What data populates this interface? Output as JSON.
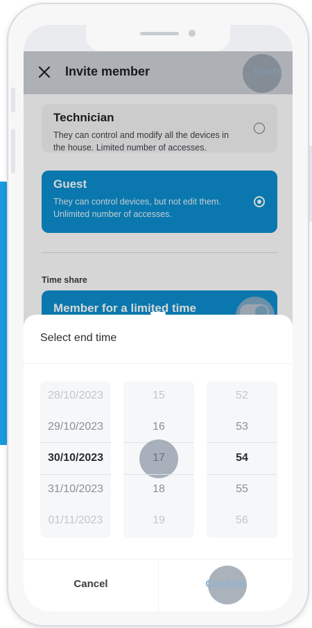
{
  "header": {
    "title": "Invite member",
    "invite_label": "Invite"
  },
  "roles": [
    {
      "title": "Technician",
      "description": "They can control and modify all the devices in the house. Limited number of accesses.",
      "selected": false
    },
    {
      "title": "Guest",
      "description": "They can control devices, but not edit them. Unlimited number of accesses.",
      "selected": true
    }
  ],
  "time_share": {
    "section_label": "Time share",
    "option_label": "Member for a limited time"
  },
  "picker": {
    "title": "Select end time",
    "dates": [
      "28/10/2023",
      "29/10/2023",
      "30/10/2023",
      "31/10/2023",
      "01/11/2023"
    ],
    "hours": [
      "15",
      "16",
      "17",
      "18",
      "19"
    ],
    "minutes": [
      "52",
      "53",
      "54",
      "55",
      "56"
    ],
    "cancel_label": "Cancel",
    "confirm_label": "Confirm"
  },
  "colors": {
    "accent": "#0d8fd0",
    "header_bg": "#cfd3d9"
  }
}
